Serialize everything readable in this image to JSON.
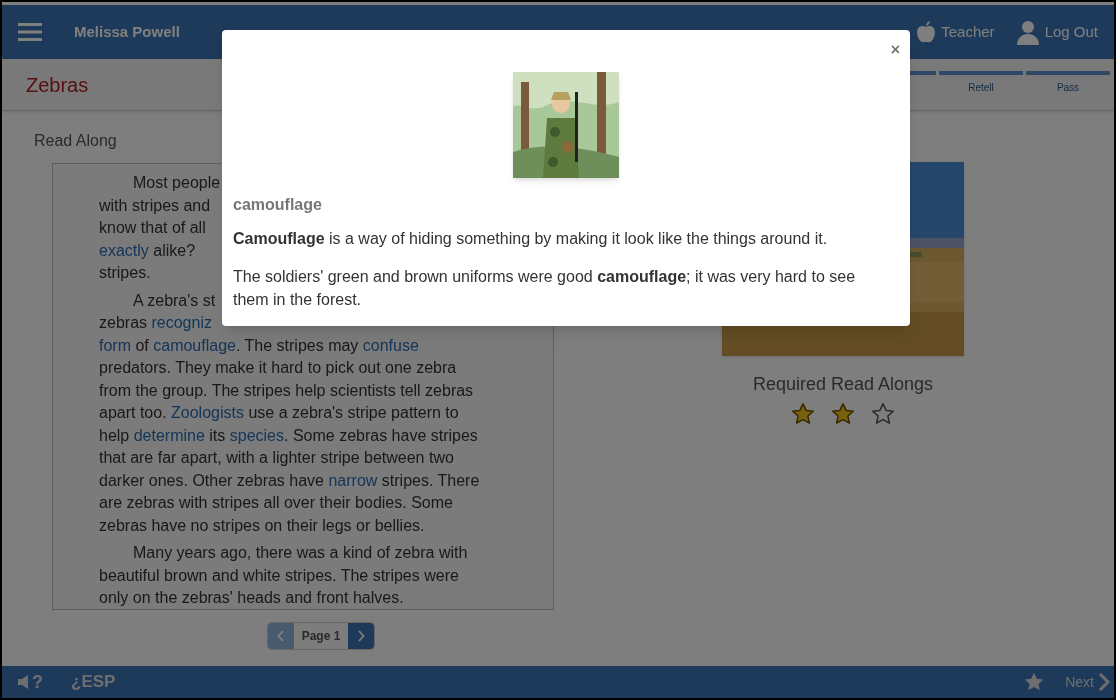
{
  "header": {
    "user_name": "Melissa Powell",
    "teacher": "Teacher",
    "log_out": "Log Out"
  },
  "title": "Zebras",
  "steps": [
    {
      "label": "Retell"
    },
    {
      "label": "Pass"
    }
  ],
  "section_label": "Read Along",
  "passage": [
    {
      "indent": true,
      "segments": [
        {
          "text": "Most people",
          "link": false
        }
      ]
    },
    {
      "indent": false,
      "segments": [
        {
          "text": "with stripes and",
          "link": false
        }
      ]
    },
    {
      "indent": false,
      "segments": [
        {
          "text": "know that of all",
          "link": false
        }
      ]
    },
    {
      "indent": false,
      "segments": [
        {
          "text": "exactly",
          "link": true
        },
        {
          "text": " alike?",
          "link": false
        }
      ]
    },
    {
      "indent": false,
      "segments": [
        {
          "text": "stripes.",
          "link": false
        }
      ]
    },
    {
      "indent": true,
      "segments": [
        {
          "text": "A zebra's st",
          "link": false
        }
      ]
    },
    {
      "indent": false,
      "segments": [
        {
          "text": "zebras ",
          "link": false
        },
        {
          "text": "recogniz",
          "link": true
        }
      ]
    },
    {
      "indent": false,
      "segments": [
        {
          "text": "form",
          "link": true
        },
        {
          "text": " of ",
          "link": false
        },
        {
          "text": "camouflage",
          "link": true
        },
        {
          "text": ". The stripes may ",
          "link": false
        },
        {
          "text": "confuse",
          "link": true
        }
      ]
    },
    {
      "indent": false,
      "segments": [
        {
          "text": "predators. They make it hard to pick out one zebra",
          "link": false
        }
      ]
    },
    {
      "indent": false,
      "segments": [
        {
          "text": "from the group. The stripes help scientists tell zebras",
          "link": false
        }
      ]
    },
    {
      "indent": false,
      "segments": [
        {
          "text": "apart too. ",
          "link": false
        },
        {
          "text": "Zoologists",
          "link": true
        },
        {
          "text": " use a zebra's stripe pattern to",
          "link": false
        }
      ]
    },
    {
      "indent": false,
      "segments": [
        {
          "text": "help ",
          "link": false
        },
        {
          "text": "determine",
          "link": true
        },
        {
          "text": " its ",
          "link": false
        },
        {
          "text": "species",
          "link": true
        },
        {
          "text": ". Some zebras have stripes",
          "link": false
        }
      ]
    },
    {
      "indent": false,
      "segments": [
        {
          "text": "that are far apart, with a lighter stripe between two",
          "link": false
        }
      ]
    },
    {
      "indent": false,
      "segments": [
        {
          "text": "darker ones. Other zebras have ",
          "link": false
        },
        {
          "text": "narrow",
          "link": true
        },
        {
          "text": " stripes. There",
          "link": false
        }
      ]
    },
    {
      "indent": false,
      "segments": [
        {
          "text": "are zebras with stripes all over their bodies. Some",
          "link": false
        }
      ]
    },
    {
      "indent": false,
      "segments": [
        {
          "text": "zebras have no stripes on their legs or bellies.",
          "link": false
        }
      ]
    },
    {
      "indent": true,
      "segments": [
        {
          "text": "Many years ago, there was a kind of zebra with",
          "link": false
        }
      ]
    },
    {
      "indent": false,
      "segments": [
        {
          "text": "beautiful brown and white stripes. The stripes were",
          "link": false
        }
      ]
    },
    {
      "indent": false,
      "segments": [
        {
          "text": "only on the zebras' heads and front halves.",
          "link": false
        }
      ]
    }
  ],
  "pager": {
    "label": "Page 1",
    "prev_disabled": true,
    "next_disabled": false
  },
  "required": {
    "label": "Required Read Alongs",
    "stars": 2
  },
  "footer": {
    "audio_help": "?",
    "language": "¿ESP",
    "next": "Next"
  },
  "modal": {
    "close": "×",
    "word": "camouflage",
    "definition": "**Camouflage** is a way of hiding something by making it look like the things around it.",
    "example": "The soldiers' green and brown uniforms were good **camouflage**; it was very hard to see them in the forest."
  }
}
